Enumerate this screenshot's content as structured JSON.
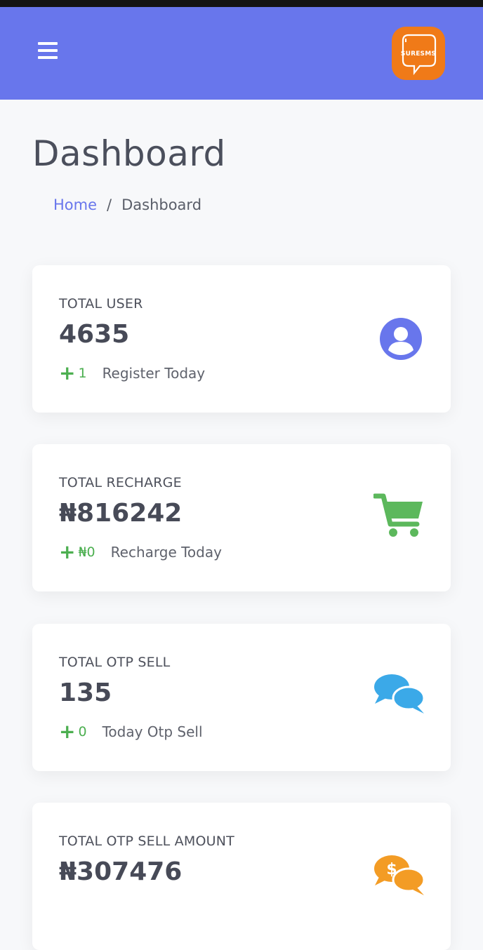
{
  "header": {
    "menu_icon": "hamburger-menu-icon",
    "logo_text": "SURESMS",
    "brand_color": "#6876ec",
    "logo_color": "#f07a18"
  },
  "page": {
    "title": "Dashboard",
    "breadcrumb": {
      "home": "Home",
      "separator": "/",
      "current": "Dashboard"
    }
  },
  "cards": [
    {
      "label": "TOTAL USER",
      "value": "4635",
      "delta": "1",
      "foot": "Register Today",
      "icon": "user-icon",
      "icon_color": "#6876ec"
    },
    {
      "label": "TOTAL RECHARGE",
      "value": "₦816242",
      "delta": "₦0",
      "foot": "Recharge Today",
      "icon": "cart-icon",
      "icon_color": "#5cb85c"
    },
    {
      "label": "TOTAL OTP SELL",
      "value": "135",
      "delta": "0",
      "foot": "Today Otp Sell",
      "icon": "chat-icon",
      "icon_color": "#3ba9e8"
    },
    {
      "label": "TOTAL OTP SELL AMOUNT",
      "value": "₦307476",
      "icon": "money-chat-icon",
      "icon_color": "#f39c25"
    }
  ]
}
